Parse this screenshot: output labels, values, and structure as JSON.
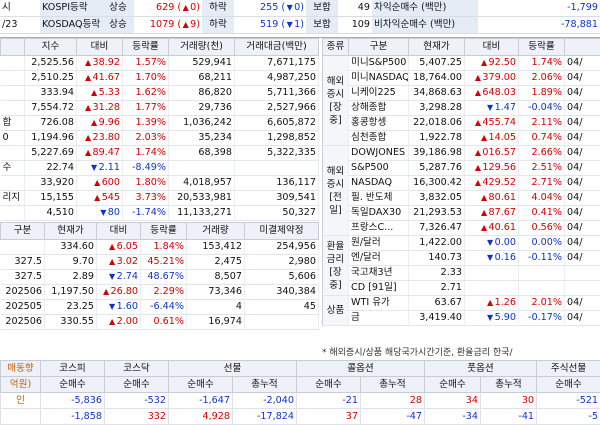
{
  "topbar": {
    "date_left": "/23",
    "kospi": {
      "label": "KOSPI등락",
      "up_label": "상승",
      "up_value": "629",
      "up_count": "0",
      "down_label": "하락",
      "down_value": "255",
      "down_count": "0",
      "flat_label": "보합",
      "flat_value": "49",
      "net_label": "차익순매수 (백만)",
      "net_value": "-1,799"
    },
    "kosdaq": {
      "label": "KOSDAQ등락",
      "up_label": "상승",
      "up_value": "1079",
      "up_count": "9",
      "down_label": "하락",
      "down_value": "519",
      "down_count": "1",
      "flat_label": "보합",
      "flat_value": "109",
      "net_label": "비차익순매수 (백만)",
      "net_value": "-78,881"
    }
  },
  "left": {
    "headers": [
      "지수",
      "대비",
      "등락률",
      "거래량(천)",
      "거래대금(백만)"
    ],
    "rows": [
      {
        "name": "",
        "value": "2,525.56",
        "dir": "up",
        "change": "38.92",
        "rate": "1.57%",
        "volume": "529,941",
        "amount": "7,671,175"
      },
      {
        "name": "",
        "value": "2,510.25",
        "dir": "up",
        "change": "41.67",
        "rate": "1.70%",
        "volume": "68,211",
        "amount": "4,987,250"
      },
      {
        "name": "",
        "value": "333.94",
        "dir": "up",
        "change": "5.33",
        "rate": "1.62%",
        "volume": "86,820",
        "amount": "5,711,366"
      },
      {
        "name": "",
        "value": "7,554.72",
        "dir": "up",
        "change": "31.28",
        "rate": "1.77%",
        "volume": "29,736",
        "amount": "2,527,966"
      },
      {
        "name": "합",
        "value": "726.08",
        "dir": "up",
        "change": "9.96",
        "rate": "1.39%",
        "volume": "1,036,242",
        "amount": "6,605,872"
      },
      {
        "name": "0",
        "value": "1,194.96",
        "dir": "up",
        "change": "23.80",
        "rate": "2.03%",
        "volume": "35,234",
        "amount": "1,298,852"
      },
      {
        "name": "",
        "value": "5,227.69",
        "dir": "up",
        "change": "89.47",
        "rate": "1.74%",
        "volume": "68,398",
        "amount": "5,322,335"
      },
      {
        "name": "수",
        "value": "22.74",
        "dir": "dn",
        "change": "2.11",
        "rate": "-8.49%",
        "volume": "",
        "amount": ""
      },
      {
        "name": "",
        "value": "33,920",
        "dir": "up",
        "change": "600",
        "rate": "1.80%",
        "volume": "4,018,957",
        "amount": "136,117"
      },
      {
        "name": "리지",
        "value": "15,155",
        "dir": "up",
        "change": "545",
        "rate": "3.73%",
        "volume": "20,533,981",
        "amount": "309,541"
      },
      {
        "name": "",
        "value": "4,510",
        "dir": "dn",
        "change": "80",
        "rate": "-1.74%",
        "volume": "11,133,271",
        "amount": "50,327"
      }
    ],
    "sub_headers": [
      "구분",
      "현재가",
      "대비",
      "등락률",
      "거래량",
      "미결제약정"
    ],
    "sub_rows": [
      {
        "name": "",
        "value": "334.60",
        "dir": "up",
        "change": "6.05",
        "rate": "1.84%",
        "volume": "153,412",
        "open": "254,956"
      },
      {
        "name": "327.5",
        "value": "9.70",
        "dir": "up",
        "change": "3.02",
        "rate": "45.21%",
        "volume": "2,475",
        "open": "2,980"
      },
      {
        "name": "327.5",
        "value": "2.89",
        "dir": "dn",
        "change": "2.74",
        "rate": "48.67%",
        "volume": "8,507",
        "open": "5,606"
      },
      {
        "name": "202506",
        "value": "1,197.50",
        "dir": "up",
        "change": "26.80",
        "rate": "2.29%",
        "volume": "73,346",
        "open": "340,384"
      },
      {
        "name": "202505",
        "value": "23.25",
        "dir": "dn",
        "change": "1.60",
        "rate": "-6.44%",
        "volume": "4",
        "open": "45"
      },
      {
        "name": "202506",
        "value": "330.55",
        "dir": "up",
        "change": "2.00",
        "rate": "0.61%",
        "volume": "16,974",
        "open": ""
      }
    ]
  },
  "right": {
    "headers": [
      "종류",
      "구분",
      "현재가",
      "대비",
      "등락률",
      ""
    ],
    "groups": [
      {
        "label": "해외증시[장중]",
        "rows": [
          {
            "name": "미니S&P500",
            "value": "5,407.25",
            "dir": "up",
            "change": "92.50",
            "rate": "1.74%",
            "time": "04/"
          },
          {
            "name": "미니NASDAQ",
            "value": "18,764.00",
            "dir": "up",
            "change": "379.00",
            "rate": "2.06%",
            "time": "04/"
          },
          {
            "name": "니케이225",
            "value": "34,868.63",
            "dir": "up",
            "change": "648.03",
            "rate": "1.89%",
            "time": "04/"
          },
          {
            "name": "상해종합",
            "value": "3,298.28",
            "dir": "dn",
            "change": "1.47",
            "rate": "-0.04%",
            "time": "04/"
          },
          {
            "name": "홍콩항셍",
            "value": "22,018.06",
            "dir": "up",
            "change": "455.74",
            "rate": "2.11%",
            "time": "04/"
          },
          {
            "name": "심천종합",
            "value": "1,922.78",
            "dir": "up",
            "change": "14.05",
            "rate": "0.74%",
            "time": "04/"
          }
        ]
      },
      {
        "label": "해외증시[전일]",
        "rows": [
          {
            "name": "DOWJONES",
            "value": "39,186.98",
            "dir": "up",
            "change": "016.57",
            "rate": "2.66%",
            "time": "04/"
          },
          {
            "name": "S&P500",
            "value": "5,287.76",
            "dir": "up",
            "change": "129.56",
            "rate": "2.51%",
            "time": "04/"
          },
          {
            "name": "NASDAQ",
            "value": "16,300.42",
            "dir": "up",
            "change": "429.52",
            "rate": "2.71%",
            "time": "04/"
          },
          {
            "name": "필. 반도체",
            "value": "3,832.05",
            "dir": "up",
            "change": "80.61",
            "rate": "4.04%",
            "time": "04/"
          },
          {
            "name": "독일DAX30",
            "value": "21,293.53",
            "dir": "up",
            "change": "87.67",
            "rate": "0.41%",
            "time": "04/"
          },
          {
            "name": "프랑스C...",
            "value": "7,326.47",
            "dir": "up",
            "change": "40.61",
            "rate": "0.56%",
            "time": "04/"
          }
        ]
      },
      {
        "label": "환율금리[장중]",
        "rows": [
          {
            "name": "원/달러",
            "value": "1,422.00",
            "dir": "dn",
            "change": "0.00",
            "rate": "0.00%",
            "time": "04/"
          },
          {
            "name": "엔/달러",
            "value": "140.73",
            "dir": "dn",
            "change": "0.16",
            "rate": "-0.11%",
            "time": "04/"
          },
          {
            "name": "국고채3년",
            "value": "2.33",
            "dir": "",
            "change": "",
            "rate": "",
            "time": ""
          },
          {
            "name": "CD [91일]",
            "value": "2.71",
            "dir": "",
            "change": "",
            "rate": "",
            "time": ""
          }
        ]
      },
      {
        "label": "상품",
        "rows": [
          {
            "name": "WTI 유가",
            "value": "63.67",
            "dir": "up",
            "change": "1.26",
            "rate": "2.01%",
            "time": "04/"
          },
          {
            "name": "금",
            "value": "3,419.40",
            "dir": "dn",
            "change": "5.90",
            "rate": "-0.17%",
            "time": "04/"
          }
        ]
      }
    ],
    "note": "* 해외증시/상품 해당국가시간기준, 환율금리 한국/"
  },
  "bottom": {
    "group_headers": [
      "매동향",
      "코스피",
      "코스닥",
      "선물",
      "콜옵션",
      "풋옵션",
      "주식선물"
    ],
    "unit": "억원)",
    "sub_headers": [
      "순매수",
      "순매수",
      "순매수",
      "총누적",
      "순매수",
      "총누적",
      "순매수",
      "총누적",
      "순매수"
    ],
    "rows": [
      {
        "label": "인",
        "values": [
          "-5,836",
          "-532",
          "-1,647",
          "-2,040",
          "-21",
          "28",
          "34",
          "30",
          "-521"
        ]
      },
      {
        "label": "",
        "values": [
          "-1,858",
          "332",
          "4,928",
          "-17,824",
          "37",
          "-47",
          "-34",
          "-41",
          "-5"
        ]
      }
    ]
  }
}
